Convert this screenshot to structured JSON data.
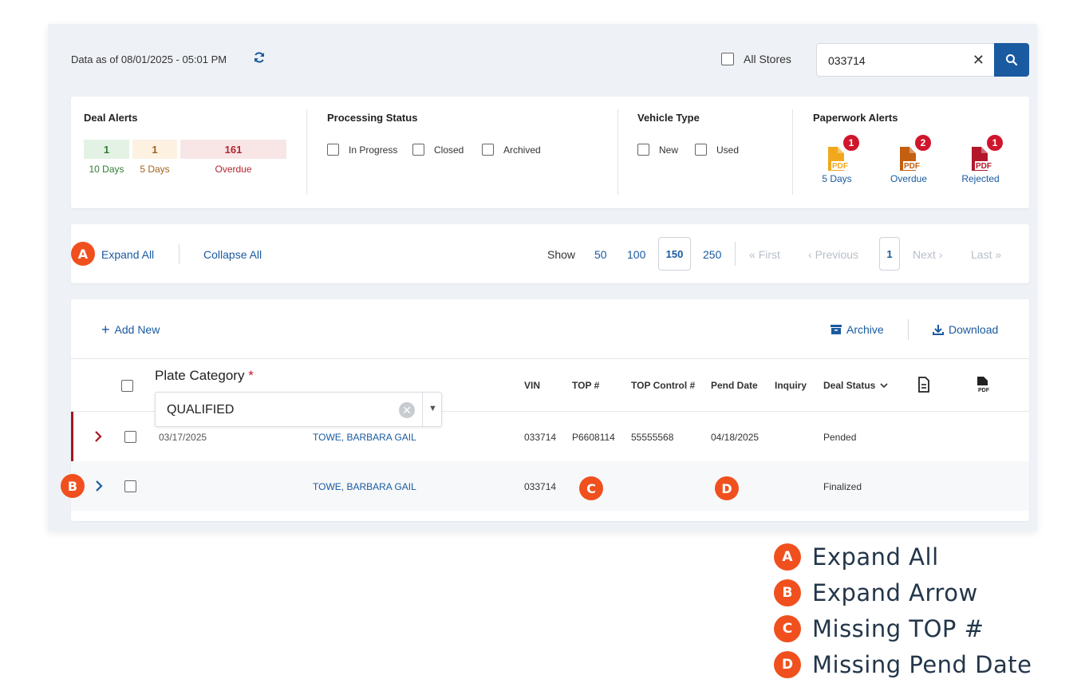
{
  "header": {
    "data_as_of": "Data as of 08/01/2025 - 05:01 PM",
    "all_stores_label": "All Stores",
    "search_value": "033714"
  },
  "filters": {
    "deal_alerts": {
      "title": "Deal Alerts",
      "items": [
        {
          "count": "1",
          "label": "10 Days",
          "color": "#2e7d32",
          "bg": "#e3f2e4"
        },
        {
          "count": "1",
          "label": "5 Days",
          "color": "#a0621c",
          "bg": "#fdf1e2"
        },
        {
          "count": "161",
          "label": "Overdue",
          "color": "#b3262e",
          "bg": "#f8e6e7"
        }
      ]
    },
    "processing_status": {
      "title": "Processing Status",
      "options": [
        "In Progress",
        "Closed",
        "Archived"
      ]
    },
    "vehicle_type": {
      "title": "Vehicle Type",
      "options": [
        "New",
        "Used"
      ]
    },
    "paperwork_alerts": {
      "title": "Paperwork Alerts",
      "items": [
        {
          "label": "5 Days",
          "badge": "1",
          "color": "#f2a81d"
        },
        {
          "label": "Overdue",
          "badge": "2",
          "color": "#c45f10"
        },
        {
          "label": "Rejected",
          "badge": "1",
          "color": "#b3172b"
        }
      ],
      "pdf_text": "PDF"
    }
  },
  "pager": {
    "expand_all": "Expand All",
    "collapse_all": "Collapse All",
    "show_label": "Show",
    "sizes": [
      "50",
      "100",
      "150",
      "250"
    ],
    "selected_size": "150",
    "first": "First",
    "previous": "Previous",
    "current_page": "1",
    "next": "Next",
    "last": "Last"
  },
  "table": {
    "add_new": "Add New",
    "archive": "Archive",
    "download": "Download",
    "plate_category": {
      "label": "Plate Category",
      "required_mark": "*",
      "value": "QUALIFIED"
    },
    "columns": {
      "vin": "VIN",
      "top": "TOP #",
      "top_control": "TOP Control #",
      "pend_date": "Pend Date",
      "inquiry": "Inquiry",
      "deal_status": "Deal Status"
    },
    "pdf_icon_text": "PDF",
    "rows": [
      {
        "date": "03/17/2025",
        "name": "TOWE, BARBARA GAIL",
        "vin": "033714",
        "top": "P6608114",
        "top_control": "55555568",
        "pend_date": "04/18/2025",
        "inquiry": "",
        "status": "Pended"
      },
      {
        "date": "",
        "name": "TOWE, BARBARA GAIL",
        "vin": "033714",
        "top": "",
        "top_control": "",
        "pend_date": "",
        "inquiry": "",
        "status": "Finalized"
      }
    ]
  },
  "markers": {
    "a": "A",
    "b": "B",
    "c": "C",
    "d": "D"
  },
  "legend": [
    {
      "marker": "A",
      "text": "Expand All"
    },
    {
      "marker": "B",
      "text": "Expand Arrow"
    },
    {
      "marker": "C",
      "text": "Missing TOP #"
    },
    {
      "marker": "D",
      "text": "Missing Pend Date"
    }
  ],
  "colors": {
    "brand_blue": "#1a5aa0",
    "marker_orange": "#f0501e",
    "alert_red": "#d0152c",
    "row_accent": "#a3171f"
  }
}
